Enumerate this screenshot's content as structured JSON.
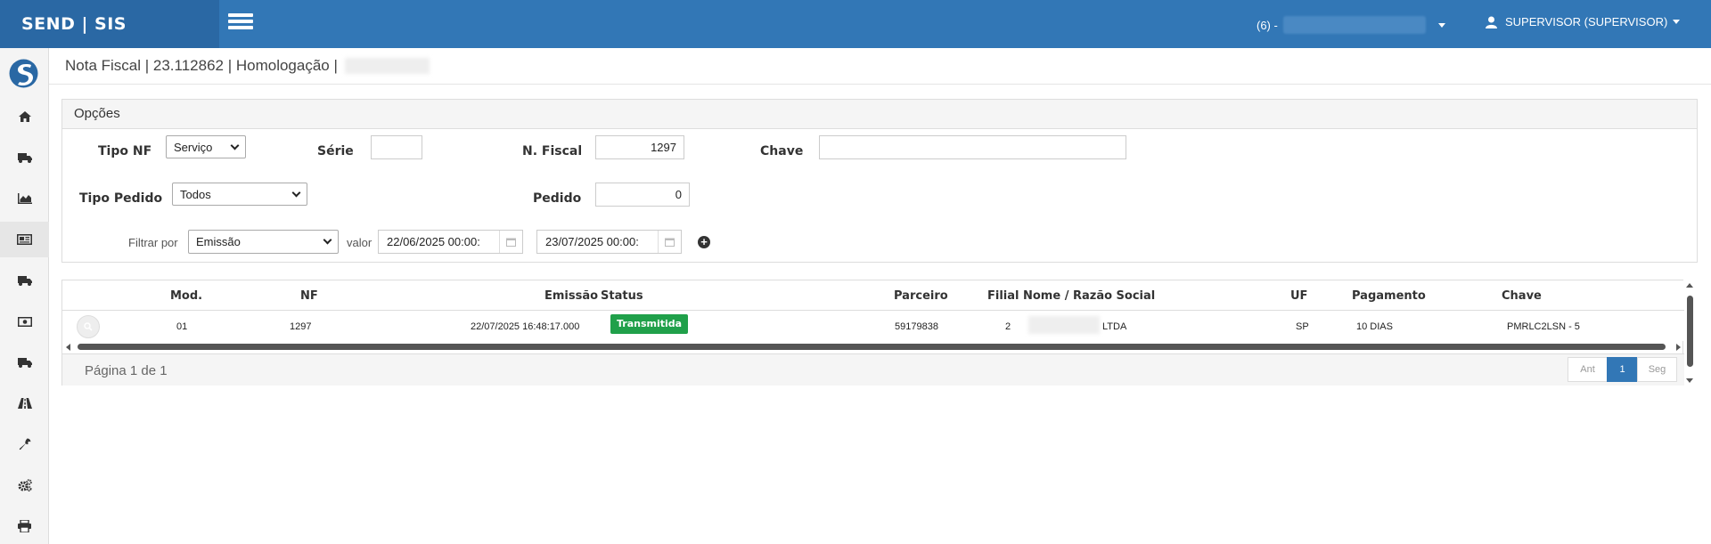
{
  "app": {
    "brand": "SEND | SIS",
    "company_prefix": "(6) -",
    "user": "SUPERVISOR (SUPERVISOR)"
  },
  "colors": {
    "navbar": "#3277b6",
    "brand_bg": "#2a68a4",
    "status_transmitida": "#20a04a"
  },
  "sidebar": {
    "items": [
      {
        "icon": "home-icon"
      },
      {
        "icon": "truck-icon"
      },
      {
        "icon": "area-chart-icon"
      },
      {
        "icon": "newspaper-icon",
        "active": true
      },
      {
        "icon": "truck-icon"
      },
      {
        "icon": "money-icon"
      },
      {
        "icon": "truck-icon"
      },
      {
        "icon": "road-icon"
      },
      {
        "icon": "wrench-icon"
      },
      {
        "icon": "cogs-icon"
      },
      {
        "icon": "print-icon"
      }
    ]
  },
  "page": {
    "title": "Nota Fiscal | 23.112862 | Homologação |"
  },
  "options": {
    "heading": "Opções",
    "tipo_nf_label": "Tipo NF",
    "tipo_nf_value": "Serviço",
    "serie_label": "Série",
    "serie_value": "",
    "nfiscal_label": "N. Fiscal",
    "nfiscal_value": "1297",
    "chave_label": "Chave",
    "chave_value": "",
    "tipo_pedido_label": "Tipo Pedido",
    "tipo_pedido_value": "Todos",
    "pedido_label": "Pedido",
    "pedido_value": "0",
    "filtrar_label": "Filtrar por",
    "filtrar_value": "Emissão",
    "valor_label": "valor",
    "date_from": "22/06/2025 00:00:",
    "date_to": "23/07/2025 00:00:"
  },
  "grid": {
    "columns": [
      "Mod.",
      "NF",
      "Emissão",
      "Status",
      "Parceiro",
      "Filial",
      "Nome / Razão Social",
      "UF",
      "Pagamento",
      "Chave"
    ],
    "rows": [
      {
        "mod": "01",
        "nf": "1297",
        "emissao": "22/07/2025 16:48:17.000",
        "status": "Transmitida",
        "parceiro": "59179838",
        "filial": "2",
        "nome": "LTDA",
        "uf": "SP",
        "pagamento": "10 DIAS",
        "chave": "PMRLC2LSN - 5"
      }
    ],
    "page_info": "Página 1 de 1",
    "pager": {
      "prev": "Ant",
      "current": "1",
      "next": "Seg"
    }
  }
}
